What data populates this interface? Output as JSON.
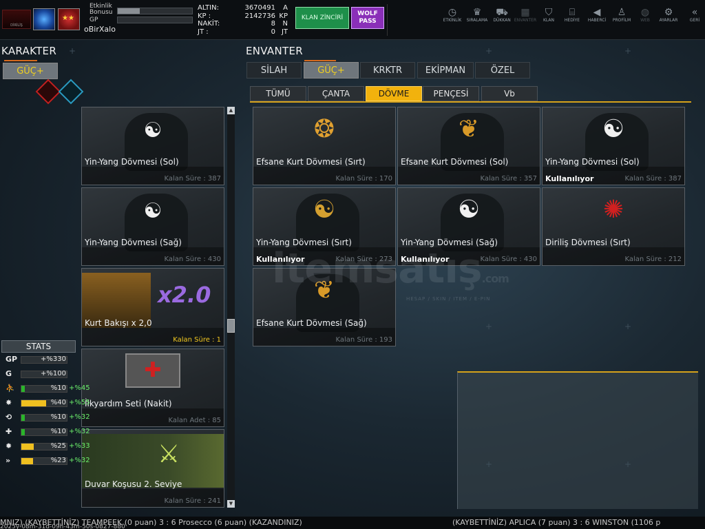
{
  "topbar": {
    "logo_text": "DİRİLİŞ",
    "nickname": "oBirXalo",
    "bonus_label_1": "Etkinlik",
    "bonus_label_2": "Bonusu",
    "gp_label": "GP",
    "bonus_progress": 0.3,
    "gp_progress": 0,
    "currency": [
      {
        "label": "ALTIN:",
        "value": "3670491",
        "unit": "A"
      },
      {
        "label": "KP   :",
        "value": "2142736",
        "unit": "KP"
      },
      {
        "label": "NAKİT:",
        "value": "8",
        "unit": "N"
      },
      {
        "label": "JT   :",
        "value": "0",
        "unit": "JT"
      }
    ],
    "klan_zinciri": "KLAN ZİNCİRİ",
    "wolf_pass_1": "WOLF",
    "wolf_pass_2": "PASS",
    "nav": [
      {
        "label": "ETKİNLİK",
        "icon": "clock-icon",
        "glyph": "◷"
      },
      {
        "label": "SIRALAMA",
        "icon": "medal-icon",
        "glyph": "♛"
      },
      {
        "label": "DÜKKAN",
        "icon": "cart-icon",
        "glyph": "⛟"
      },
      {
        "label": "ENVANTER",
        "icon": "inventory-icon",
        "glyph": "▦"
      },
      {
        "label": "KLAN",
        "icon": "shield-icon",
        "glyph": "⛉"
      },
      {
        "label": "HEDİYE",
        "icon": "gift-icon",
        "glyph": "⌸"
      },
      {
        "label": "HABERCİ",
        "icon": "megaphone-icon",
        "glyph": "◀"
      },
      {
        "label": "PROFİLM",
        "icon": "profile-icon",
        "glyph": "♙"
      },
      {
        "label": "WEB",
        "icon": "globe-icon",
        "glyph": "◍"
      },
      {
        "label": "AYARLAR",
        "icon": "gear-icon",
        "glyph": "⚙"
      },
      {
        "label": "GERİ",
        "icon": "back-icon",
        "glyph": "«"
      }
    ]
  },
  "karakter": {
    "title": "KARAKTER",
    "tab": "GÜÇ+",
    "items": [
      {
        "name": "Yin-Yang Dövmesi (Sol)",
        "time": "Kalan Süre : 387",
        "icon": "☯"
      },
      {
        "name": "Yin-Yang Dövmesi (Sağ)",
        "time": "Kalan Süre : 430",
        "icon": "☯"
      },
      {
        "name": "Kurt Bakışı x 2,0",
        "time": "Kalan Süre : 1",
        "icon": "x2.0"
      },
      {
        "name": "İlkyardım Seti (Nakit)",
        "time": "Kalan Adet : 85",
        "icon": "✚"
      },
      {
        "name": "Duvar Koşusu 2. Seviye",
        "time": "Kalan Süre : 241",
        "icon": "⚔"
      }
    ]
  },
  "stats": {
    "title": "STATS",
    "rows": [
      {
        "icon": "GP",
        "value": "+%330",
        "extra": "",
        "fill": 0,
        "color": "#2ab52a"
      },
      {
        "icon": "G",
        "value": "+%100",
        "extra": "",
        "fill": 0,
        "color": "#2ab52a"
      },
      {
        "icon": "run-icon",
        "glyph": "⛹",
        "value": "%10",
        "extra": "+%45",
        "fill": 0.08,
        "color": "#2ab52a"
      },
      {
        "icon": "dash-icon",
        "glyph": "✸",
        "value": "%40",
        "extra": "+%55",
        "fill": 0.55,
        "color": "#f0c020"
      },
      {
        "icon": "reload-icon",
        "glyph": "⟲",
        "value": "%10",
        "extra": "+%32",
        "fill": 0.08,
        "color": "#2ab52a"
      },
      {
        "icon": "heal-icon",
        "glyph": "✚",
        "value": "%10",
        "extra": "+%32",
        "fill": 0.08,
        "color": "#2ab52a"
      },
      {
        "icon": "grenade-icon",
        "glyph": "✹",
        "value": "%25",
        "extra": "+%33",
        "fill": 0.28,
        "color": "#f0c020"
      },
      {
        "icon": "speed-icon",
        "glyph": "»",
        "value": "%23",
        "extra": "+%32",
        "fill": 0.26,
        "color": "#f0c020"
      }
    ]
  },
  "envanter": {
    "title": "ENVANTER",
    "tabs": [
      "SİLAH",
      "GÜÇ+",
      "KRKTR",
      "EKİPMAN",
      "ÖZEL"
    ],
    "active_tab": "GÜÇ+",
    "subtabs": [
      "TÜMÜ",
      "ÇANTA",
      "DÖVME",
      "PENÇESİ",
      "Vb"
    ],
    "active_subtab": "DÖVME",
    "items": [
      {
        "name": "Efsane Kurt Dövmesi (Sırt)",
        "time": "Kalan Süre : 170",
        "used": "",
        "icon": "❂",
        "color": "#e0a030"
      },
      {
        "name": "Efsane Kurt Dövmesi (Sol)",
        "time": "Kalan Süre : 357",
        "used": "",
        "icon": "❦",
        "color": "#d89a28"
      },
      {
        "name": "Yin-Yang Dövmesi (Sol)",
        "time": "Kalan Süre : 387",
        "used": "Kullanılıyor",
        "icon": "☯",
        "color": "#f0f0f0"
      },
      {
        "name": "Yin-Yang Dövmesi (Sırt)",
        "time": "Kalan Süre : 273",
        "used": "Kullanılıyor",
        "icon": "☯",
        "color": "#d4a030"
      },
      {
        "name": "Yin-Yang Dövmesi (Sağ)",
        "time": "Kalan Süre : 430",
        "used": "Kullanılıyor",
        "icon": "☯",
        "color": "#f0f0f0"
      },
      {
        "name": "Diriliş Dövmesi (Sırt)",
        "time": "Kalan Süre : 212",
        "used": "",
        "icon": "✺",
        "color": "#d02020"
      },
      {
        "name": "Efsane Kurt Dövmesi (Sağ)",
        "time": "Kalan Süre : 193",
        "used": "",
        "icon": "❦",
        "color": "#d89a28"
      }
    ]
  },
  "watermark": {
    "main": "itemsatış",
    "domain": ".com",
    "sub": "HESAP / SKIN / ITEM / E-PIN"
  },
  "ticker": {
    "left": "MNIZ) (KAYBETTİNİZ) TEAMPEEK (0 puan) 3 : 6 Prosecco (6 puan) (KAZANDINIZ)",
    "right": "(KAYBETTİNİZ) APLICA (7 puan) 3 : 6 WINSTON (1106 p",
    "timestamp": "2025y-08m-31d-09h-43m-50s-0827-880"
  }
}
